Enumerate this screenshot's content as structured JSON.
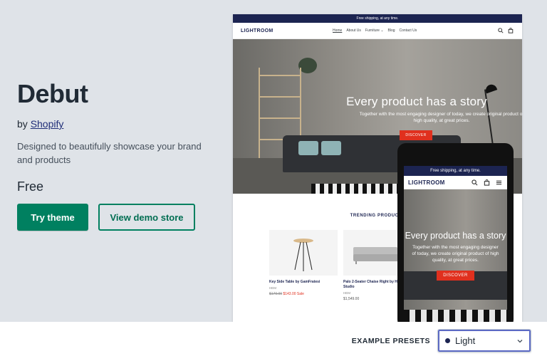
{
  "theme": {
    "title": "Debut",
    "by_prefix": "by",
    "author": "Shopify",
    "description": "Designed to beautifully showcase your brand and products",
    "price": "Free",
    "try_label": "Try theme",
    "demo_label": "View demo store"
  },
  "desktop_preview": {
    "announcement": "Free shipping, at any time.",
    "logo": "LIGHTROOM",
    "nav": [
      "Home",
      "About Us",
      "Furniture ⌄",
      "Blog",
      "Contact Us"
    ],
    "hero_title": "Every product has a story",
    "hero_subtitle": "Together with the most engaging designer of today, we create original product of high quality, at great prices.",
    "hero_button": "DISCOVER",
    "trending_title": "TRENDING PRODUCTS",
    "products": [
      {
        "name": "Key Side Table by GamFratesi",
        "vendor": "HEM",
        "price_old": "$179.00",
        "price_new": "$143.00 Sale"
      },
      {
        "name": "Palo 2-Seater Chaise Right by Hi Design Studio",
        "vendor": "HEM",
        "price": "$1,549.00"
      }
    ]
  },
  "mobile_preview": {
    "announcement": "Free shipping, at any time.",
    "logo": "LIGHTROOM",
    "hero_title": "Every product has a story",
    "hero_subtitle": "Together with the most engaging designer of today, we create original product of high quality, at great prices.",
    "hero_button": "DISCOVER"
  },
  "presets": {
    "label": "EXAMPLE PRESETS",
    "selected": "Light",
    "swatch_color": "#1c2451"
  },
  "colors": {
    "primary": "#008060",
    "background": "#dfe3e8",
    "accent_red": "#e0301e",
    "navy": "#1c2451"
  }
}
